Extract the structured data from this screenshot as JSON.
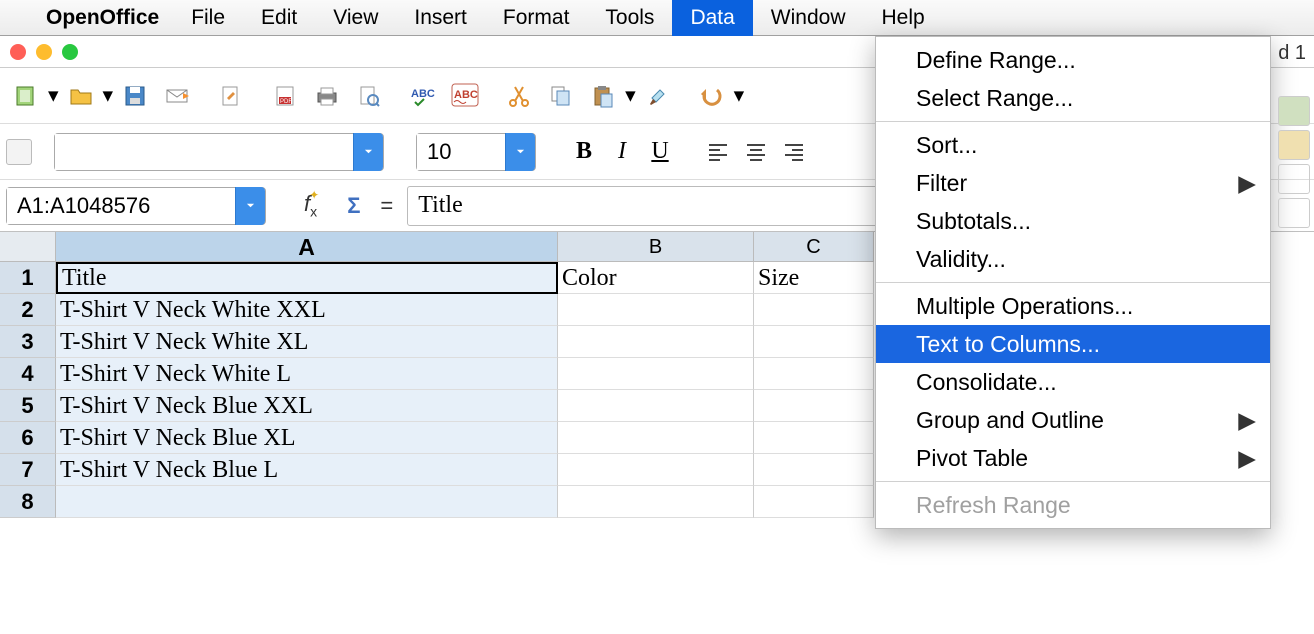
{
  "menubar": {
    "appname": "OpenOffice",
    "items": [
      "File",
      "Edit",
      "View",
      "Insert",
      "Format",
      "Tools",
      "Data",
      "Window",
      "Help"
    ],
    "active": "Data"
  },
  "title_ext": "d 1",
  "toolbar2": {
    "font_name": "",
    "font_size": "10"
  },
  "formulabar": {
    "cellref": "A1:A1048576",
    "formula": "Title"
  },
  "grid": {
    "cols": [
      "A",
      "B",
      "C"
    ],
    "rows": [
      {
        "r": "1",
        "A": "Title",
        "B": "Color",
        "C": "Size",
        "active": true
      },
      {
        "r": "2",
        "A": "T-Shirt V Neck White XXL",
        "B": "",
        "C": ""
      },
      {
        "r": "3",
        "A": "T-Shirt V Neck White XL",
        "B": "",
        "C": ""
      },
      {
        "r": "4",
        "A": "T-Shirt V Neck White L",
        "B": "",
        "C": ""
      },
      {
        "r": "5",
        "A": "T-Shirt V Neck Blue XXL",
        "B": "",
        "C": ""
      },
      {
        "r": "6",
        "A": "T-Shirt V Neck Blue XL",
        "B": "",
        "C": ""
      },
      {
        "r": "7",
        "A": "T-Shirt V Neck Blue L",
        "B": "",
        "C": ""
      },
      {
        "r": "8",
        "A": "",
        "B": "",
        "C": ""
      }
    ]
  },
  "data_menu": {
    "groups": [
      [
        {
          "label": "Define Range...",
          "sub": false,
          "dis": false
        },
        {
          "label": "Select Range...",
          "sub": false,
          "dis": false
        }
      ],
      [
        {
          "label": "Sort...",
          "sub": false,
          "dis": false
        },
        {
          "label": "Filter",
          "sub": true,
          "dis": false
        },
        {
          "label": "Subtotals...",
          "sub": false,
          "dis": false
        },
        {
          "label": "Validity...",
          "sub": false,
          "dis": false
        }
      ],
      [
        {
          "label": "Multiple Operations...",
          "sub": false,
          "dis": false
        },
        {
          "label": "Text to Columns...",
          "sub": false,
          "dis": false,
          "sel": true
        },
        {
          "label": "Consolidate...",
          "sub": false,
          "dis": false
        },
        {
          "label": "Group and Outline",
          "sub": true,
          "dis": false
        },
        {
          "label": "Pivot Table",
          "sub": true,
          "dis": false
        }
      ],
      [
        {
          "label": "Refresh Range",
          "sub": false,
          "dis": true
        }
      ]
    ]
  }
}
